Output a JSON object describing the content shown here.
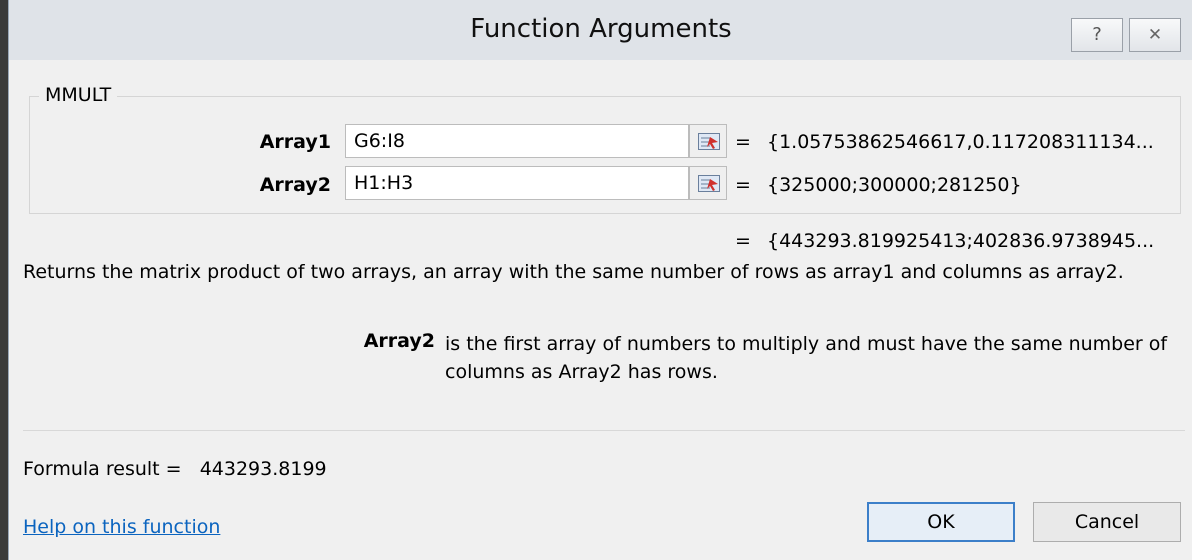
{
  "window": {
    "title": "Function Arguments",
    "help_glyph": "?",
    "close_glyph": "✕"
  },
  "function": {
    "name": "MMULT",
    "args": [
      {
        "label": "Array1",
        "value": "G6:I8",
        "evaluated": "{1.05753862546617,0.117208311134..."
      },
      {
        "label": "Array2",
        "value": "H1:H3",
        "evaluated": "{325000;300000;281250}"
      }
    ],
    "equals": "=",
    "result_preview": "{443293.819925413;402836.9738945...",
    "description": "Returns the matrix product of two arrays, an array with the same number of rows as array1 and columns as array2.",
    "arg_help_name": "Array2",
    "arg_help_text": "is the first array of numbers to multiply and must have the same number of columns as Array2 has rows."
  },
  "formula_result": {
    "label": "Formula result =",
    "value": "443293.8199"
  },
  "footer": {
    "help_link": "Help on this function",
    "ok_label": "OK",
    "cancel_label": "Cancel"
  },
  "icons": {
    "help": "help-icon",
    "close": "close-icon",
    "collapse": "collapse-dialog-icon"
  }
}
